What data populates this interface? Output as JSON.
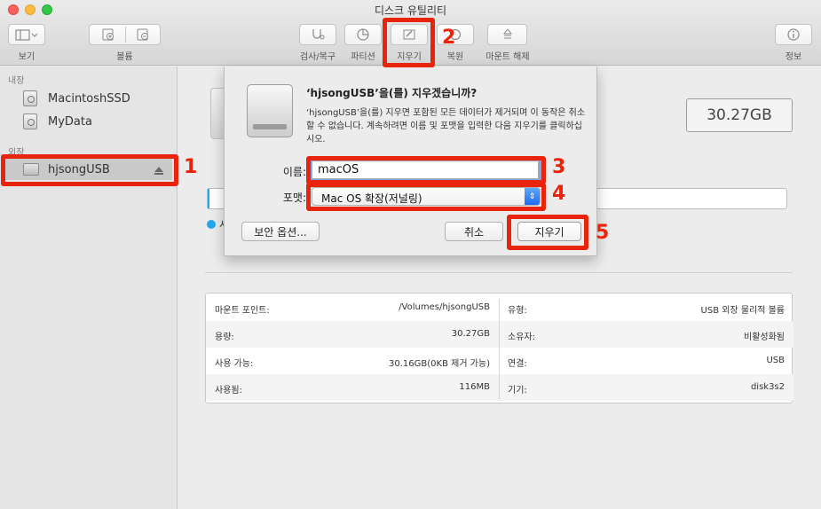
{
  "window": {
    "title": "디스크 유틸리티"
  },
  "toolbar": {
    "view_label": "보기",
    "volume_label": "볼륨",
    "first_aid_label": "검사/복구",
    "partition_label": "파티션",
    "erase_label": "지우기",
    "restore_label": "복원",
    "unmount_label": "마운트 해제",
    "info_label": "정보"
  },
  "sidebar": {
    "internal_header": "내장",
    "external_header": "외장",
    "internal_items": [
      {
        "label": "MacintoshSSD",
        "icon": "internal-disk-icon"
      },
      {
        "label": "MyData",
        "icon": "internal-disk-icon"
      }
    ],
    "external_items": [
      {
        "label": "hjsongUSB",
        "icon": "usb-drive-icon",
        "selected": true
      }
    ]
  },
  "main": {
    "capacity": "30.27GB",
    "legend_partial": "시",
    "info": {
      "left": [
        {
          "key": "마운트 포인트:",
          "value": "/Volumes/hjsongUSB"
        },
        {
          "key": "용량:",
          "value": "30.27GB"
        },
        {
          "key": "사용 가능:",
          "value": "30.16GB(0KB 제거 가능)"
        },
        {
          "key": "사용됨:",
          "value": "116MB"
        }
      ],
      "right": [
        {
          "key": "유형:",
          "value": "USB 외장 물리적 볼륨"
        },
        {
          "key": "소유자:",
          "value": "비활성화됨"
        },
        {
          "key": "연결:",
          "value": "USB"
        },
        {
          "key": "기기:",
          "value": "disk3s2"
        }
      ]
    }
  },
  "dialog": {
    "title": "‘hjsongUSB’을(를) 지우겠습니까?",
    "message": "‘hjsongUSB’을(를) 지우면 포함된 모든 데이터가 제거되며 이 동작은 취소할 수 없습니다. 계속하려면 이름 및 포맷을 입력한 다음 지우기를 클릭하십시오.",
    "name_label": "이름:",
    "name_value": "macOS",
    "format_label": "포맷:",
    "format_value": "Mac OS 확장(저널링)",
    "security_button": "보안 옵션...",
    "cancel_button": "취소",
    "erase_button": "지우기"
  },
  "annotations": {
    "numbers": [
      "1",
      "2",
      "3",
      "4",
      "5"
    ],
    "color": "#e8250c"
  },
  "colors": {
    "accent": "#1e6df0",
    "usage": "#1ea7e8"
  }
}
